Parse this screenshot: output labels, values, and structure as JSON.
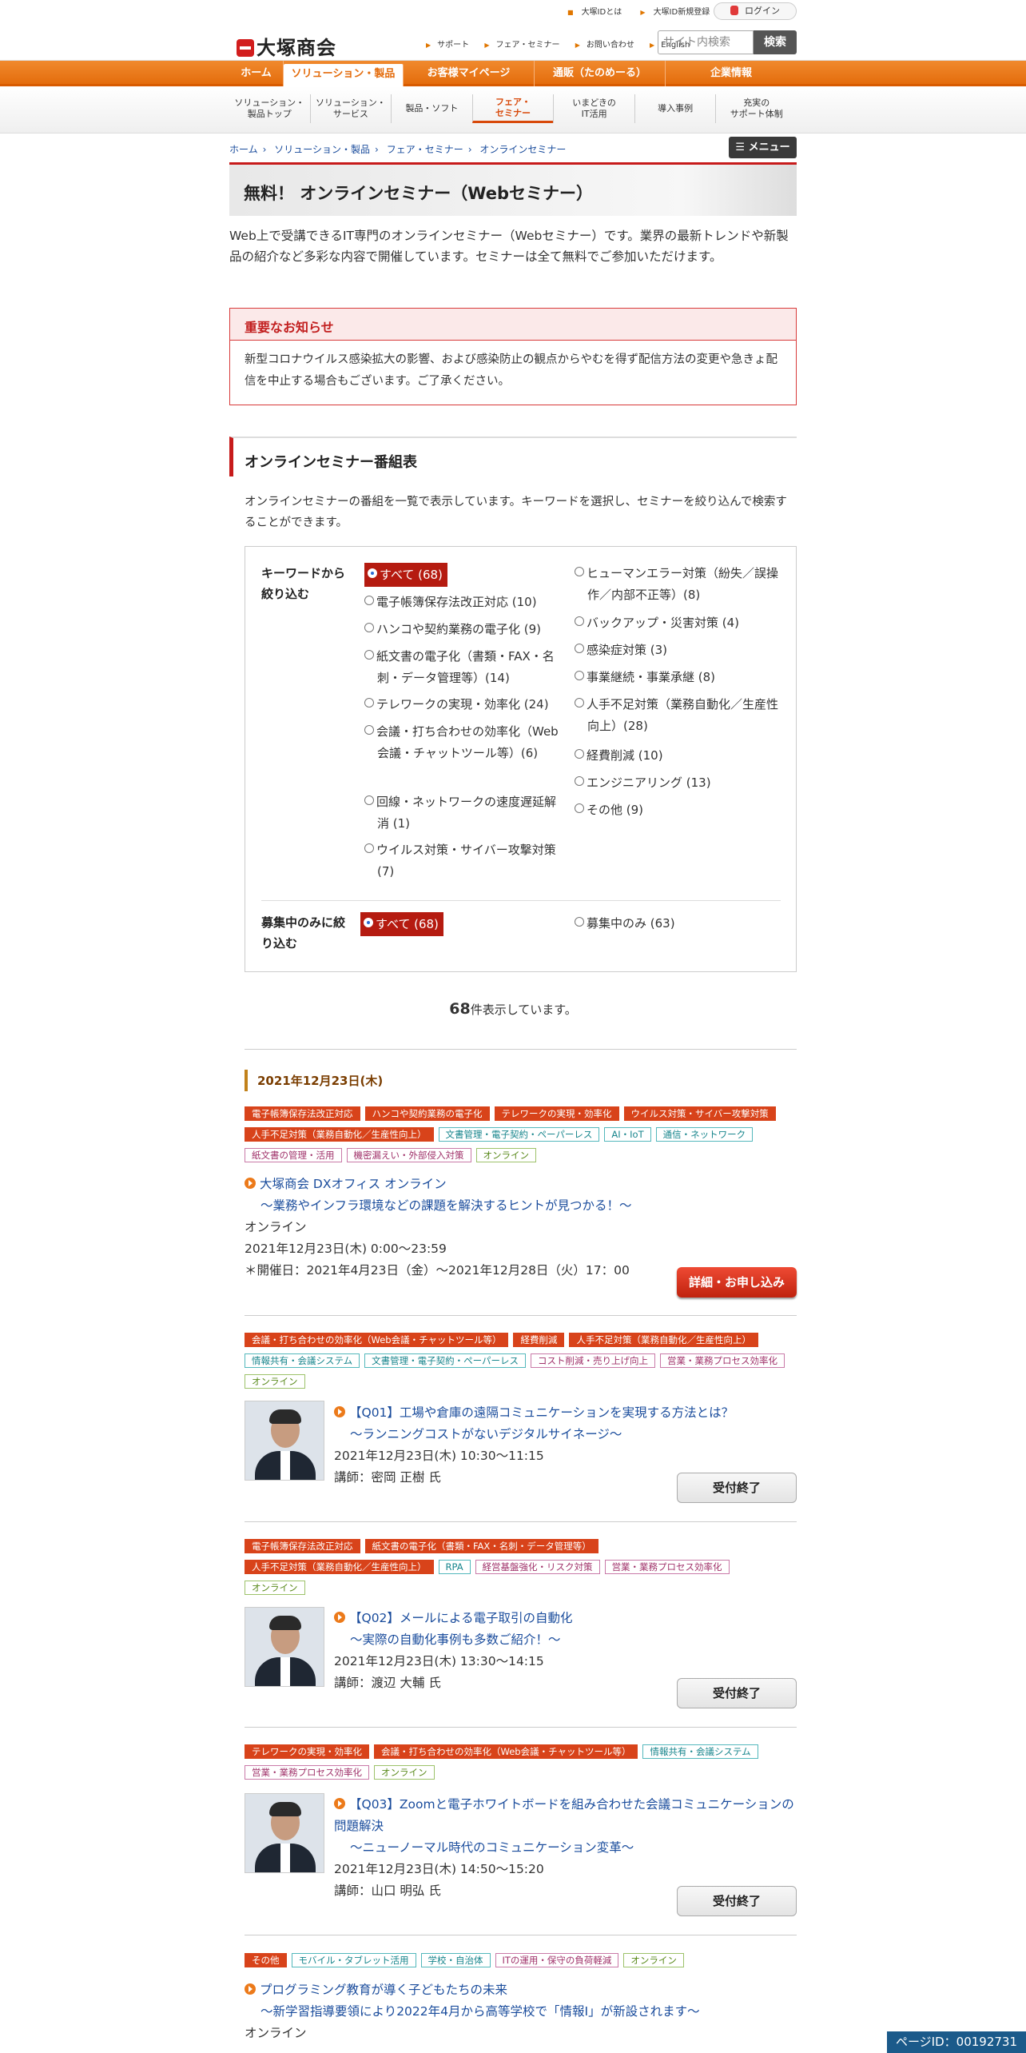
{
  "header": {
    "logo": "大塚商会",
    "top_links": [
      "大塚IDとは",
      "大塚ID新規登録"
    ],
    "login": "ログイン",
    "sub_links": [
      "サポート",
      "フェア・セミナー",
      "お問い合わせ",
      "English"
    ],
    "search_placeholder": "サイト内検索",
    "search_button": "検索"
  },
  "main_nav": [
    "ホーム",
    "ソリューション・製品",
    "お客様マイページ",
    "通販（たのめーる）",
    "企業情報"
  ],
  "sub_nav": [
    {
      "l1": "ソリューション・",
      "l2": "製品トップ"
    },
    {
      "l1": "ソリューション・",
      "l2": "サービス"
    },
    {
      "l1": "製品・ソフト",
      "l2": ""
    },
    {
      "l1": "フェア・",
      "l2": "セミナー"
    },
    {
      "l1": "いまどきの",
      "l2": "IT活用"
    },
    {
      "l1": "導入事例",
      "l2": ""
    },
    {
      "l1": "充実の",
      "l2": "サポート体制"
    }
  ],
  "breadcrumb": [
    "ホーム",
    "ソリューション・製品",
    "フェア・セミナー",
    "オンラインセミナー"
  ],
  "menu_button": "メニュー",
  "page_title": "無料！ オンラインセミナー（Webセミナー）",
  "intro": "Web上で受講できるIT専門のオンラインセミナー（Webセミナー）です。業界の最新トレンドや新製品の紹介など多彩な内容で開催しています。セミナーは全て無料でご参加いただけます。",
  "notice": {
    "title": "重要なお知らせ",
    "body": "新型コロナウイルス感染拡大の影響、および感染防止の観点からやむを得ず配信方法の変更や急きょ配信を中止する場合もございます。ご了承ください。"
  },
  "section": {
    "title": "オンラインセミナー番組表",
    "desc": "オンラインセミナーの番組を一覧で表示しています。キーワードを選択し、セミナーを絞り込んで検索することができます。"
  },
  "filter": {
    "keyword_label": "キーワードから絞り込む",
    "left_options": [
      "すべて (68)",
      "電子帳簿保存法改正対応 (10)",
      "ハンコや契約業務の電子化 (9)",
      "紙文書の電子化（書類・FAX・名刺・データ管理等）(14)",
      "テレワークの実現・効率化 (24)",
      "会議・打ち合わせの効率化（Web会議・チャットツール等）(6)",
      "回線・ネットワークの速度遅延解消 (1)",
      "ウイルス対策・サイバー攻撃対策 (7)"
    ],
    "right_options": [
      "ヒューマンエラー対策（紛失／誤操作／内部不正等）(8)",
      "バックアップ・災害対策 (4)",
      "感染症対策 (3)",
      "事業継続・事業承継 (8)",
      "人手不足対策（業務自動化／生産性向上）(28)",
      "経費削減 (10)",
      "エンジニアリング (13)",
      "その他 (9)"
    ],
    "recruit_label": "募集中のみに絞り込む",
    "recruit_all": "すべて (68)",
    "recruit_only": "募集中のみ (63)"
  },
  "count": {
    "num": "68",
    "suffix": "件表示しています。"
  },
  "date_heading": "2021年12月23日(木)",
  "events": [
    {
      "tags": [
        [
          "電子帳簿保存法改正対応",
          "red"
        ],
        [
          "ハンコや契約業務の電子化",
          "red"
        ],
        [
          "テレワークの実現・効率化",
          "red"
        ],
        [
          "ウイルス対策・サイバー攻撃対策",
          "red"
        ],
        [
          "人手不足対策（業務自動化／生産性向上）",
          "red"
        ],
        [
          "文書管理・電子契約・ペーパーレス",
          "teal"
        ],
        [
          "AI・IoT",
          "teal"
        ],
        [
          "通信・ネットワーク",
          "teal"
        ],
        [
          "紙文書の管理・活用",
          "pink"
        ],
        [
          "機密漏えい・外部侵入対策",
          "pink"
        ],
        [
          "オンライン",
          "green"
        ]
      ],
      "title": "大塚商会 DXオフィス オンライン",
      "subtitle": "～業務やインフラ環境などの課題を解決するヒントが見つかる！～",
      "place": "オンライン",
      "time": "2021年12月23日(木)  0:00～23:59",
      "note": "＊開催日：2021年4月23日（金）～2021年12月28日（火）17：00",
      "button": "詳細・お申し込み"
    },
    {
      "tags": [
        [
          "会議・打ち合わせの効率化（Web会議・チャットツール等）",
          "red"
        ],
        [
          "経費削減",
          "red"
        ],
        [
          "人手不足対策（業務自動化／生産性向上）",
          "red"
        ],
        [
          "情報共有・会議システム",
          "teal"
        ],
        [
          "文書管理・電子契約・ペーパーレス",
          "teal"
        ],
        [
          "コスト削減・売り上げ向上",
          "pink"
        ],
        [
          "営業・業務プロセス効率化",
          "pink"
        ],
        [
          "オンライン",
          "green"
        ]
      ],
      "title": "【Q01】工場や倉庫の遠隔コミュニケーションを実現する方法とは？",
      "subtitle": "～ランニングコストがないデジタルサイネージ～",
      "time": "2021年12月23日(木) 10:30～11:15",
      "speaker": "講師：密岡 正樹 氏",
      "button": "受付終了"
    },
    {
      "tags": [
        [
          "電子帳簿保存法改正対応",
          "red"
        ],
        [
          "紙文書の電子化（書類・FAX・名刺・データ管理等）",
          "red"
        ],
        [
          "人手不足対策（業務自動化／生産性向上）",
          "red"
        ],
        [
          "RPA",
          "teal"
        ],
        [
          "経営基盤強化・リスク対策",
          "pink"
        ],
        [
          "営業・業務プロセス効率化",
          "pink"
        ],
        [
          "オンライン",
          "green"
        ]
      ],
      "title": "【Q02】メールによる電子取引の自動化",
      "subtitle": "～実際の自動化事例も多数ご紹介！～",
      "time": "2021年12月23日(木) 13:30～14:15",
      "speaker": "講師：渡辺 大輔 氏",
      "button": "受付終了"
    },
    {
      "tags": [
        [
          "テレワークの実現・効率化",
          "red"
        ],
        [
          "会議・打ち合わせの効率化（Web会議・チャットツール等）",
          "red"
        ],
        [
          "情報共有・会議システム",
          "teal"
        ],
        [
          "営業・業務プロセス効率化",
          "pink"
        ],
        [
          "オンライン",
          "green"
        ]
      ],
      "title": "【Q03】Zoomと電子ホワイトボードを組み合わせた会議コミュニケーションの問題解決",
      "subtitle": "～ニューノーマル時代のコミュニケーション変革～",
      "time": "2021年12月23日(木) 14:50～15:20",
      "speaker": "講師：山口 明弘 氏",
      "button": "受付終了"
    },
    {
      "tags": [
        [
          "その他",
          "red"
        ],
        [
          "モバイル・タブレット活用",
          "teal"
        ],
        [
          "学校・自治体",
          "teal"
        ],
        [
          "ITの運用・保守の負荷軽減",
          "pink"
        ],
        [
          "オンライン",
          "green"
        ]
      ],
      "title": "プログラミング教育が導く子どもたちの未来",
      "subtitle": "～新学習指導要領により2022年4月から高等学校で「情報Ⅰ」が新設されます～",
      "place": "オンライン"
    }
  ],
  "page_id": "ページID：00192731"
}
